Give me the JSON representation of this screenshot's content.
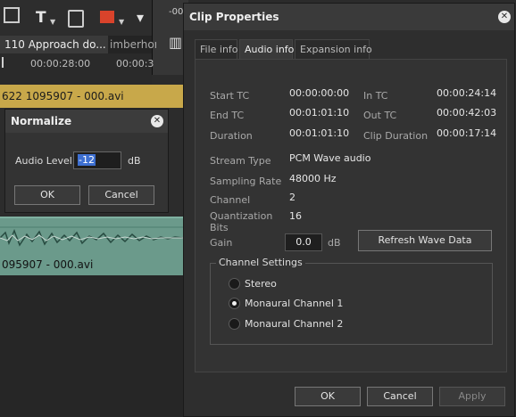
{
  "editor": {
    "tab_active": "110 Approach do...",
    "tab_inactive": "imberhor",
    "strip_text": "-00",
    "ruler_tc1": "00:00:28:00",
    "ruler_tc2": "00:00:3",
    "clip_video_label": "622 1095907 - 000.avi",
    "clip_audio_label": "095907 - 000.avi"
  },
  "normalize": {
    "title": "Normalize",
    "audio_level_label": "Audio Level",
    "audio_level_value": "-12",
    "unit": "dB",
    "ok_label": "OK",
    "cancel_label": "Cancel"
  },
  "clip_properties": {
    "title": "Clip Properties",
    "tabs": [
      {
        "label": "File info",
        "active": false
      },
      {
        "label": "Audio info",
        "active": true
      },
      {
        "label": "Expansion info",
        "active": false
      }
    ],
    "start_tc": {
      "label": "Start TC",
      "value": "00:00:00:00"
    },
    "end_tc": {
      "label": "End TC",
      "value": "00:01:01:10"
    },
    "duration": {
      "label": "Duration",
      "value": "00:01:01:10"
    },
    "in_tc": {
      "label": "In TC",
      "value": "00:00:24:14"
    },
    "out_tc": {
      "label": "Out TC",
      "value": "00:00:42:03"
    },
    "clip_duration": {
      "label": "Clip Duration",
      "value": "00:00:17:14"
    },
    "stream_type": {
      "label": "Stream Type",
      "value": "PCM Wave audio"
    },
    "sampling_rate": {
      "label": "Sampling Rate",
      "value": "48000 Hz"
    },
    "channel": {
      "label": "Channel",
      "value": "2"
    },
    "quantization": {
      "label": "Quantization Bits",
      "value": "16"
    },
    "gain": {
      "label": "Gain",
      "value": "0.0",
      "unit": "dB"
    },
    "refresh_label": "Refresh Wave Data",
    "channel_settings": {
      "legend": "Channel Settings",
      "options": [
        {
          "label": "Stereo",
          "checked": false
        },
        {
          "label": "Monaural Channel 1",
          "checked": true
        },
        {
          "label": "Monaural Channel 2",
          "checked": false
        }
      ]
    },
    "ok_label": "OK",
    "cancel_label": "Cancel",
    "apply_label": "Apply"
  },
  "icons": [
    "title-tool-icon",
    "voice-over-icon",
    "clip-marker-icon",
    "close-icon",
    "chevron-down-icon",
    "audio-meter-icon"
  ]
}
